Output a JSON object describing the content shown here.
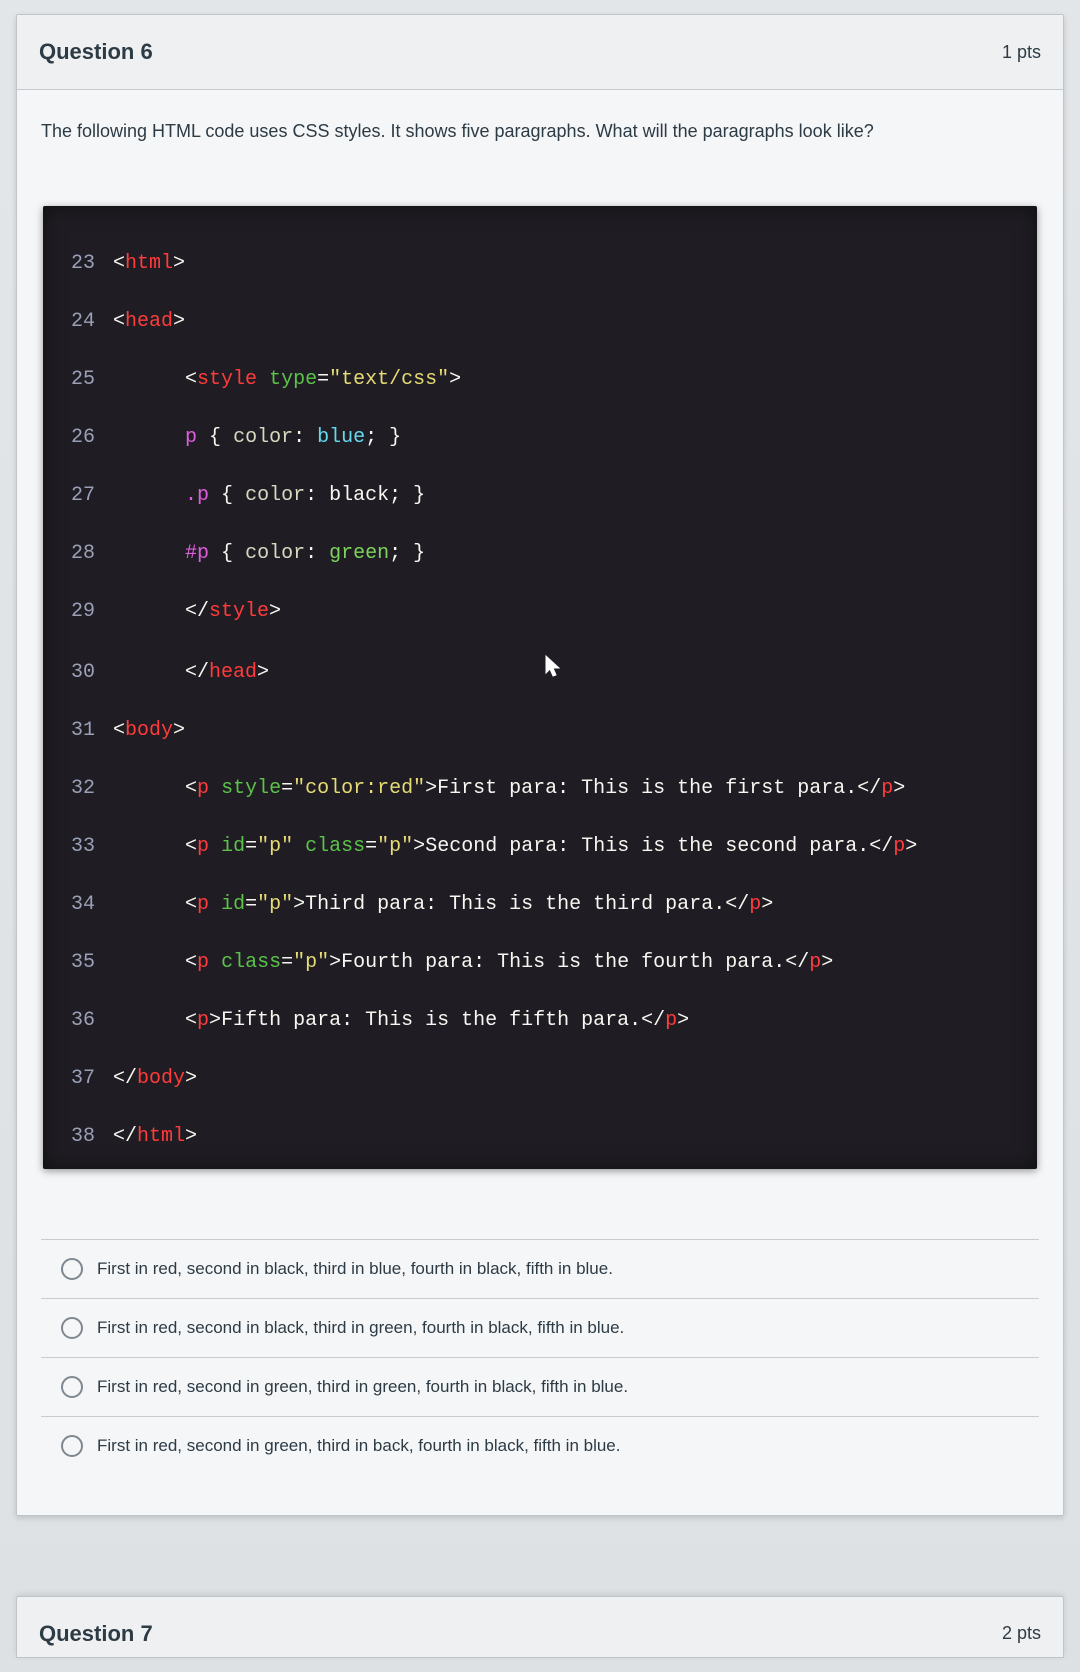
{
  "question6": {
    "title": "Question 6",
    "points": "1 pts",
    "prompt": "The following HTML code uses CSS styles. It shows five paragraphs. What will the paragraphs look like?",
    "code_lines": [
      "<html>",
      "<head>",
      "    <style type=\"text/css\">",
      "    p { color: blue; }",
      "    .p { color: black; }",
      "    #p { color: green; }",
      "    </style>",
      "    </head>",
      "<body>",
      "    <p style=\"color:red\">First para: This is the first para.</p>",
      "    <p id=\"p\" class=\"p\">Second para: This is the second para.</p>",
      "    <p id=\"p\">Third para: This is the third para.</p>",
      "    <p class=\"p\">Fourth para: This is the fourth para.</p>",
      "    <p>Fifth para: This is the fifth para.</p>",
      "</body>",
      "</html>"
    ],
    "start_line_number": 23,
    "answers": [
      "First in red, second in black, third in blue, fourth in black, fifth in blue.",
      "First in red, second in black, third in green, fourth in black, fifth in blue.",
      "First in red, second in green, third in green, fourth in black, fifth in blue.",
      "First in red, second in green, third in back, fourth in black, fifth in blue."
    ]
  },
  "question7": {
    "title": "Question 7",
    "points": "2 pts"
  },
  "syntax": {
    "tags": [
      "html",
      "head",
      "style",
      "body",
      "p",
      "/style",
      "/head",
      "/body",
      "/html",
      "/p"
    ],
    "attrs_shown": [
      "type",
      "style",
      "id",
      "class"
    ],
    "attr_values_shown": [
      "text/css",
      "color:red",
      "p"
    ],
    "css_rules": [
      {
        "selector": "p",
        "property": "color",
        "value": "blue"
      },
      {
        "selector": ".p",
        "property": "color",
        "value": "black"
      },
      {
        "selector": "#p",
        "property": "color",
        "value": "green"
      }
    ]
  }
}
